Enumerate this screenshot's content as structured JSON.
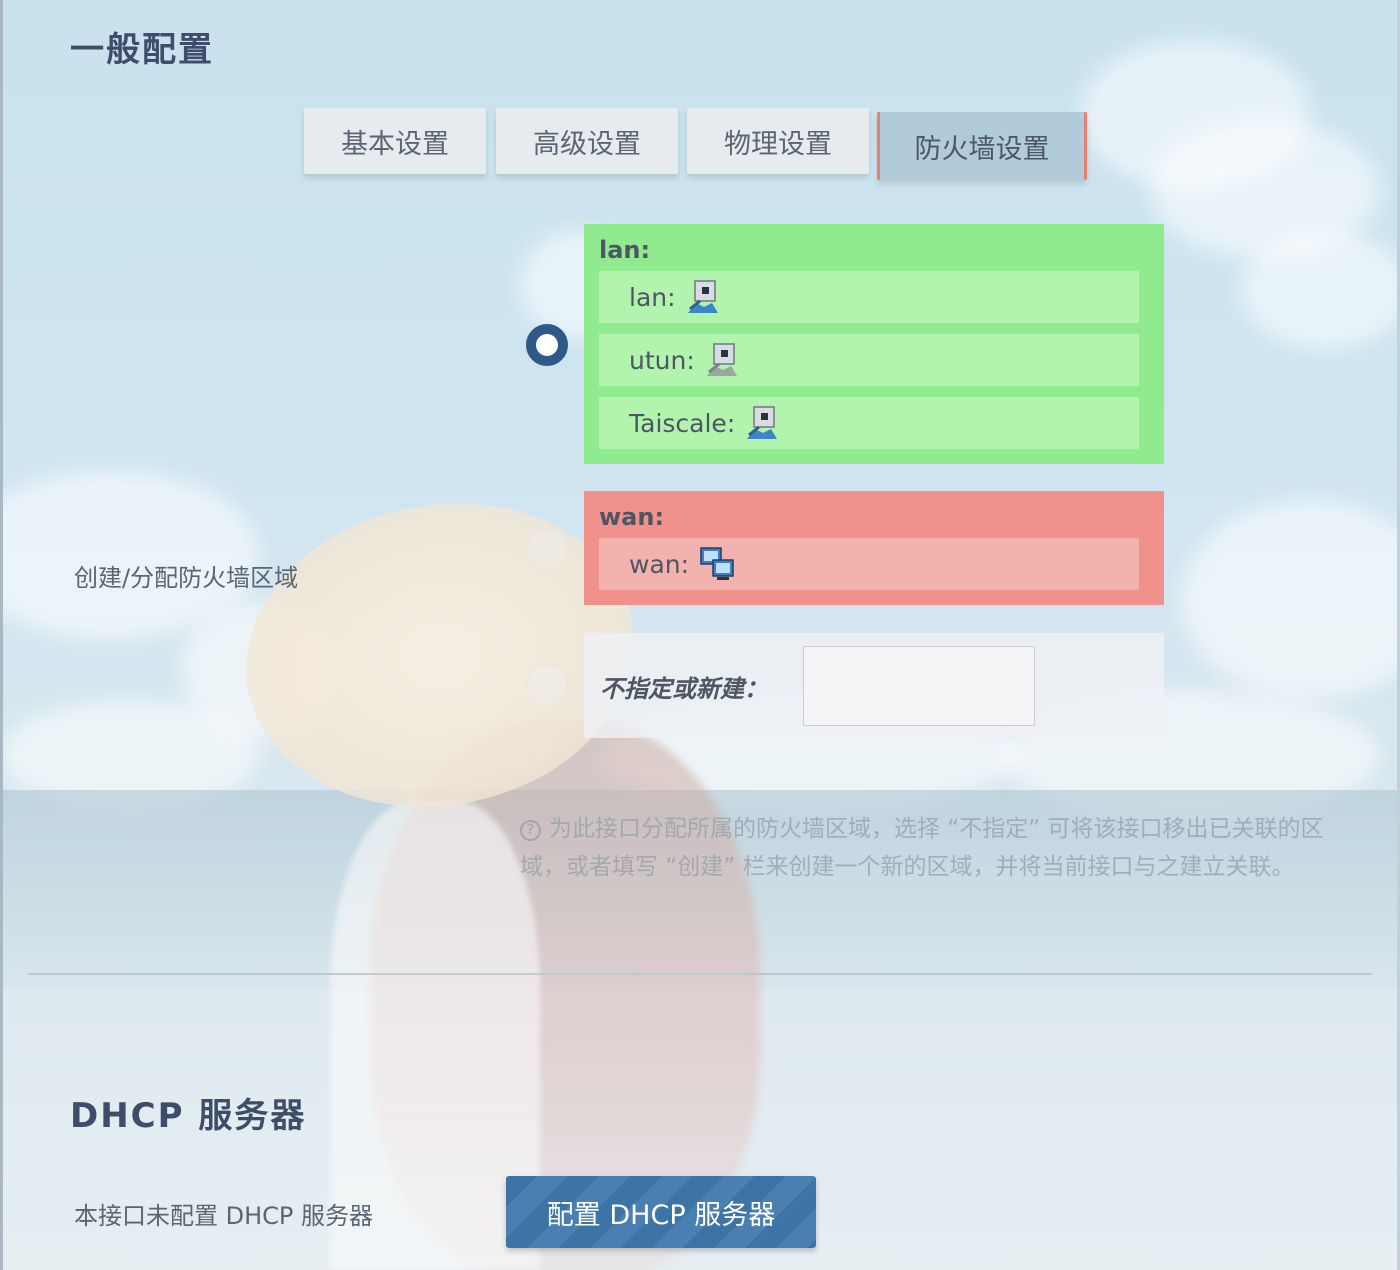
{
  "general": {
    "title": "一般配置",
    "tabs": [
      {
        "label": "基本设置",
        "active": false
      },
      {
        "label": "高级设置",
        "active": false
      },
      {
        "label": "物理设置",
        "active": false
      },
      {
        "label": "防火墙设置",
        "active": true
      }
    ]
  },
  "firewall": {
    "field_label": "创建/分配防火墙区域",
    "selected_zone": "lan",
    "zones": [
      {
        "name": "lan:",
        "color": "#90ea8e",
        "interfaces": [
          {
            "name": "lan:",
            "icon": "network-interface-icon"
          },
          {
            "name": "utun:",
            "icon": "network-interface-icon"
          },
          {
            "name": "Taiscale:",
            "icon": "network-interface-icon"
          }
        ]
      },
      {
        "name": "wan:",
        "color": "#f0918c",
        "interfaces": [
          {
            "name": "wan:",
            "icon": "computer-network-icon"
          }
        ]
      }
    ],
    "new_zone_label": "不指定或新建：",
    "new_zone_value": "",
    "help_icon": "question-circle-icon",
    "help_text": "为此接口分配所属的防火墙区域，选择 “不指定” 可将该接口移出已关联的区域，或者填写 “创建” 栏来创建一个新的区域，并将当前接口与之建立关联。"
  },
  "dhcp": {
    "title": "DHCP 服务器",
    "status_text": "本接口未配置 DHCP 服务器",
    "button_label": "配置 DHCP 服务器",
    "button_color": "#3e73a5"
  }
}
